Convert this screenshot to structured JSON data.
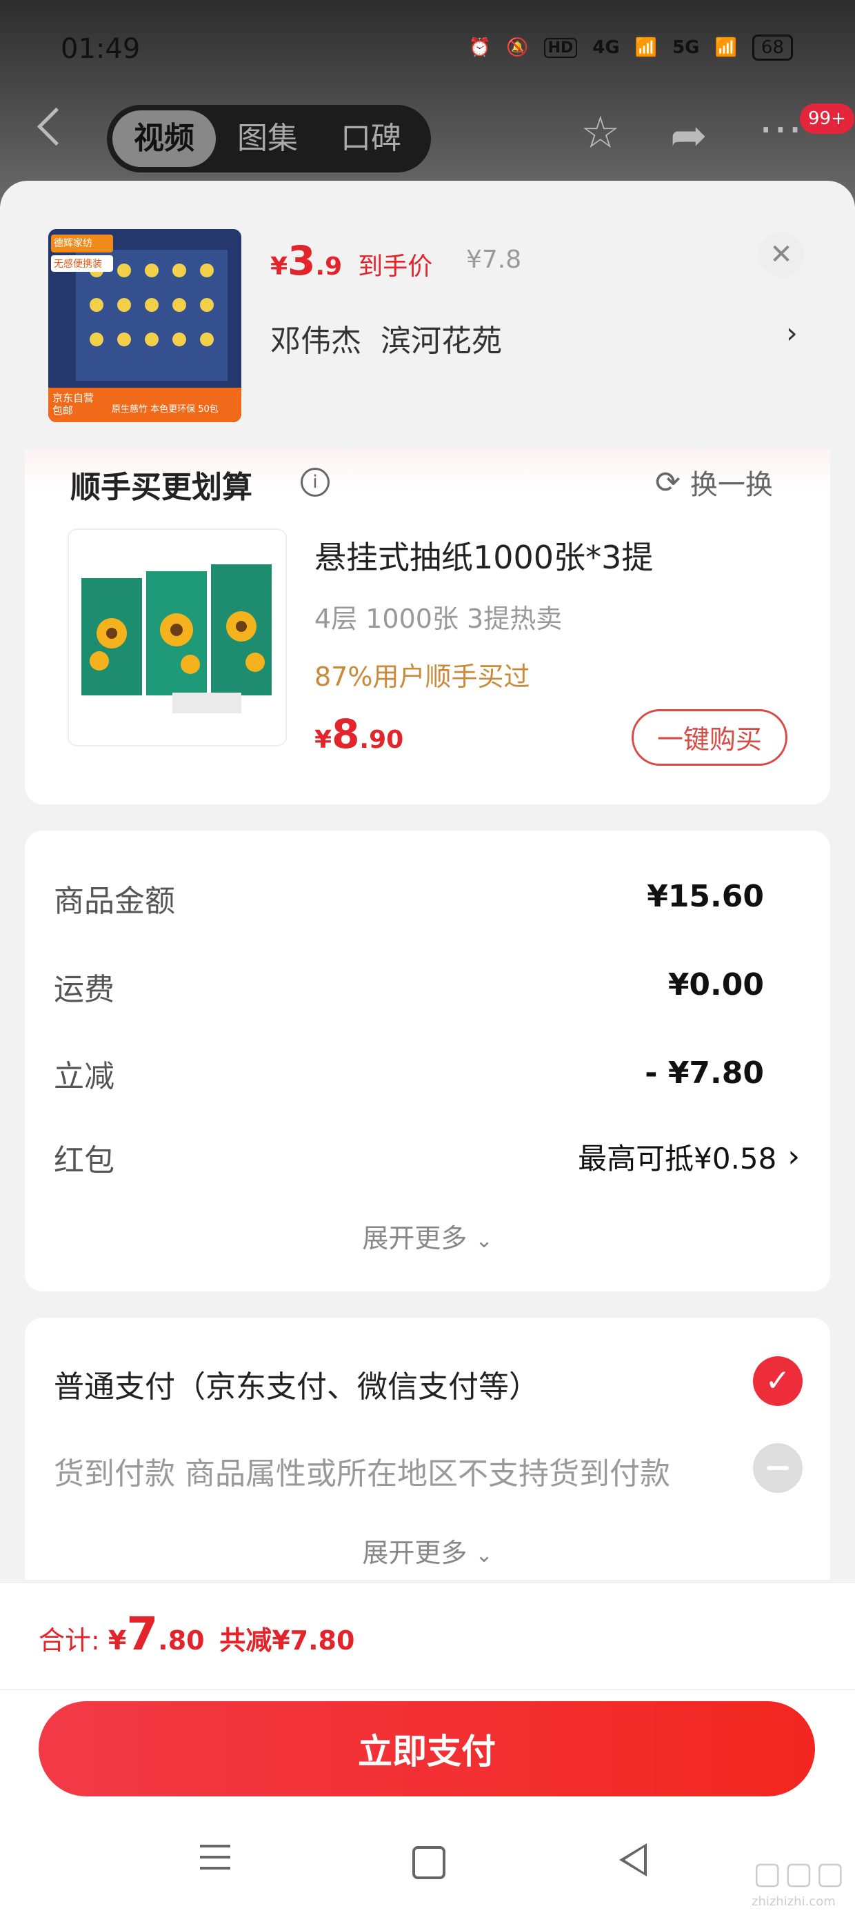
{
  "status": {
    "time": "01:49",
    "net1": "4G",
    "net2": "5G",
    "hd": "HD",
    "battery": "68"
  },
  "nav": {
    "tabs": [
      "视频",
      "图集",
      "口碑"
    ],
    "active_tab": 0,
    "badge": "99+"
  },
  "product": {
    "price_yen": "¥",
    "price_int": "3",
    "price_dec": ".9",
    "price_label": "到手价",
    "original_price": "¥7.8",
    "address": "邓伟杰  滨河花苑",
    "thumb_tags": [
      "德辉家纺",
      "无感便携装"
    ],
    "thumb_footer_left": "京东自营\n包邮",
    "thumb_footer_right": "原生慈竹 本色更环保 50包"
  },
  "addon": {
    "section_title": "顺手买更划算",
    "refresh_label": "换一换",
    "item_title": "悬挂式抽纸1000张*3提",
    "item_sub": "4层 1000张 3提热卖",
    "item_social": "87%用户顺手买过",
    "price_yen": "¥",
    "price_int": "8",
    "price_dec": ".90",
    "buy_button": "一键购买"
  },
  "summary": {
    "rows": [
      {
        "label": "商品金额",
        "value": "¥15.60"
      },
      {
        "label": "运费",
        "value": "¥0.00"
      },
      {
        "label": "立减",
        "value": "- ¥7.80"
      },
      {
        "label": "红包",
        "value": "最高可抵¥0.58"
      }
    ],
    "expand_label": "展开更多"
  },
  "payment": {
    "normal": "普通支付（京东支付、微信支付等）",
    "cod": "货到付款 商品属性或所在地区不支持货到付款",
    "expand_label": "展开更多"
  },
  "footer": {
    "total_label": "合计: ",
    "total_yen": "¥",
    "total_int": "7",
    "total_dec": ".80",
    "saved": "共减¥7.80",
    "pay_button": "立即支付"
  },
  "watermark": "zhizhizhi.com",
  "colors": {
    "accent_red": "#e3242b",
    "social_orange": "#c98a3a"
  }
}
